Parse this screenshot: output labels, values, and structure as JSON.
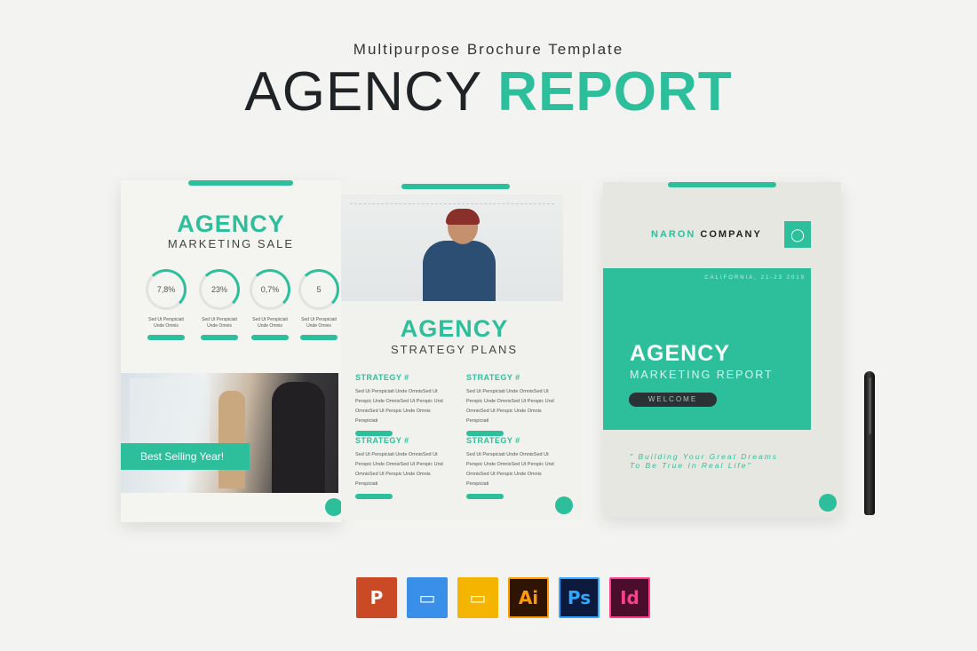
{
  "header": {
    "subtitle": "Multipurpose Brochure Template",
    "title_part1": "AGENCY",
    "title_part2": "REPORT"
  },
  "page_left": {
    "heading": "AGENCY",
    "subheading": "MARKETING SALE",
    "stats": [
      {
        "value": "7,8%",
        "label": "Sed Ut Perspiciati Unde Omnis"
      },
      {
        "value": "23%",
        "label": "Sed Ut Perspiciati Unde Omnis"
      },
      {
        "value": "0,7%",
        "label": "Sed Ut Perspiciati Unde Omnis"
      },
      {
        "value": "5",
        "label": "Sed Ut Perspiciati Unde Omnis"
      }
    ],
    "banner": "Best Selling Year!"
  },
  "page_middle": {
    "heading": "AGENCY",
    "subheading": "STRATEGY PLANS",
    "strategies": [
      {
        "title": "STRATEGY #",
        "text": "Sed Ut Perspiciati Unde OmnisSed Ut Perspic Unde OmnisSed Ut Perspic Und OmnisSed Ut Perspic Unde Omnis Perspiciati"
      },
      {
        "title": "STRATEGY #",
        "text": "Sed Ut Perspiciati Unde OmnisSed Ut Perspic Unde OmnisSed Ut Perspic Und OmnisSed Ut Perspic Unde Omnis Perspiciati"
      },
      {
        "title": "STRATEGY #",
        "text": "Sed Ut Perspiciati Unde OmnisSed Ut Perspic Unde OmnisSed Ut Perspic Und OmnisSed Ut Perspic Unde Omnis Perspiciati"
      },
      {
        "title": "STRATEGY #",
        "text": "Sed Ut Perspiciati Unde OmnisSed Ut Perspic Unde OmnisSed Ut Perspic Und OmnisSed Ut Perspic Unde Omnis Perspiciati"
      }
    ]
  },
  "page_right": {
    "company_part1": "NARON",
    "company_part2": "COMPANY",
    "date": "CALIFORNIA, 21-23 2019",
    "heading": "AGENCY",
    "subheading": "MARKETING REPORT",
    "button": "WELCOME",
    "quote_line1": "\" Building Your Great Dreams",
    "quote_line2": "To Be True In Real Life\""
  },
  "apps": [
    {
      "name": "powerpoint-icon",
      "label": "P"
    },
    {
      "name": "keynote-icon",
      "label": "▭"
    },
    {
      "name": "google-slides-icon",
      "label": "▭"
    },
    {
      "name": "illustrator-icon",
      "label": "Ai"
    },
    {
      "name": "photoshop-icon",
      "label": "Ps"
    },
    {
      "name": "indesign-icon",
      "label": "Id"
    }
  ],
  "colors": {
    "accent": "#2dbf9c",
    "background": "#f3f3f1",
    "dark": "#1f2326"
  }
}
